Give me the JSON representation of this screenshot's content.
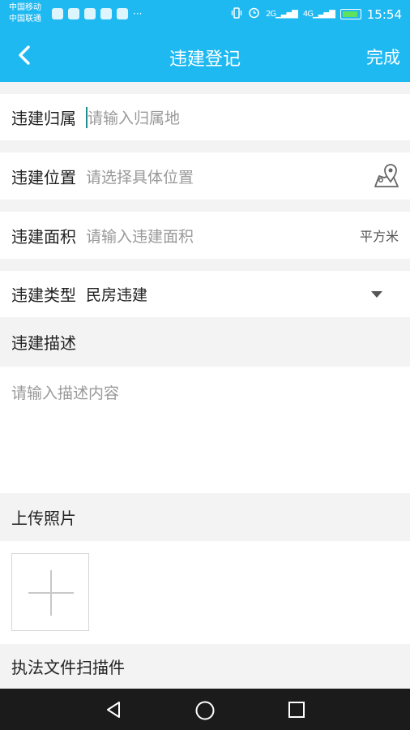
{
  "status_bar": {
    "carrier1": "中国移动",
    "carrier2": "中国联通",
    "notification_more": "···",
    "network1": "2G",
    "network2": "4G",
    "time": "15:54"
  },
  "app_bar": {
    "title": "违建登记",
    "done_label": "完成"
  },
  "form": {
    "ownership": {
      "label": "违建归属",
      "placeholder": "请输入归属地"
    },
    "location": {
      "label": "违建位置",
      "placeholder": "请选择具体位置"
    },
    "area": {
      "label": "违建面积",
      "placeholder": "请输入违建面积",
      "unit": "平方米"
    },
    "type": {
      "label": "违建类型",
      "value": "民房违建"
    },
    "description": {
      "label": "违建描述",
      "placeholder": "请输入描述内容"
    },
    "photos": {
      "label": "上传照片"
    },
    "scan": {
      "label": "执法文件扫描件"
    }
  },
  "colors": {
    "primary": "#1fb9f2",
    "cursor": "#1e8f8f"
  }
}
